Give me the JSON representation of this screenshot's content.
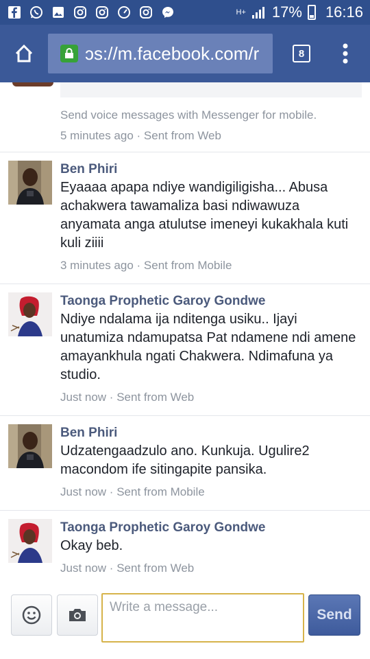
{
  "status_bar": {
    "battery": "17%",
    "time": "16:16",
    "network": "H+",
    "icons": [
      "facebook-icon",
      "whatsapp-icon",
      "gallery-icon",
      "instagram-icon",
      "instagram-icon",
      "speedometer-icon",
      "instagram-icon",
      "messenger-icon"
    ]
  },
  "browser": {
    "url": "ɔs://m.facebook.com/r",
    "tab_count": "8"
  },
  "messages": [
    {
      "sender": "",
      "text": "",
      "meta": "",
      "partial": true
    },
    {
      "sender": "",
      "text": "Send voice messages with Messenger for mobile.",
      "meta": "5 minutes ago · Sent from Web"
    },
    {
      "sender": "Ben Phiri",
      "text": "Eyaaaa apapa ndiye wandigiligisha... Abusa achakwera tawamaliza basi ndiwawuza anyamata anga atulutse imeneyi kukakhala kuti kuli ziiii",
      "meta": "3 minutes ago · Sent from Mobile"
    },
    {
      "sender": "Taonga Prophetic Garoy Gondwe",
      "text": "Ndiye ndalama ija nditenga usiku.. Ijayi unatumiza ndamupatsa Pat ndamene ndi amene amayankhula ngati Chakwera. Ndimafuna ya studio.",
      "meta": "Just now · Sent from Web"
    },
    {
      "sender": "Ben Phiri",
      "text": "Udzatengaadzulo ano. Kunkuja. Ugulire2 macondom ife sitingapite pansika.",
      "meta": "Just now · Sent from Mobile"
    },
    {
      "sender": "Taonga Prophetic Garoy Gondwe",
      "text": "Okay beb.",
      "meta": "Just now · Sent from Web"
    }
  ],
  "composer": {
    "placeholder": "Write a message...",
    "send_label": "Send"
  },
  "colors": {
    "status_bar": "#2f4f8d",
    "browser_bar": "#3b5998",
    "name": "#4b5a7c",
    "meta": "#8d949e",
    "lock": "#37a238",
    "input_border": "#d6b34a"
  }
}
